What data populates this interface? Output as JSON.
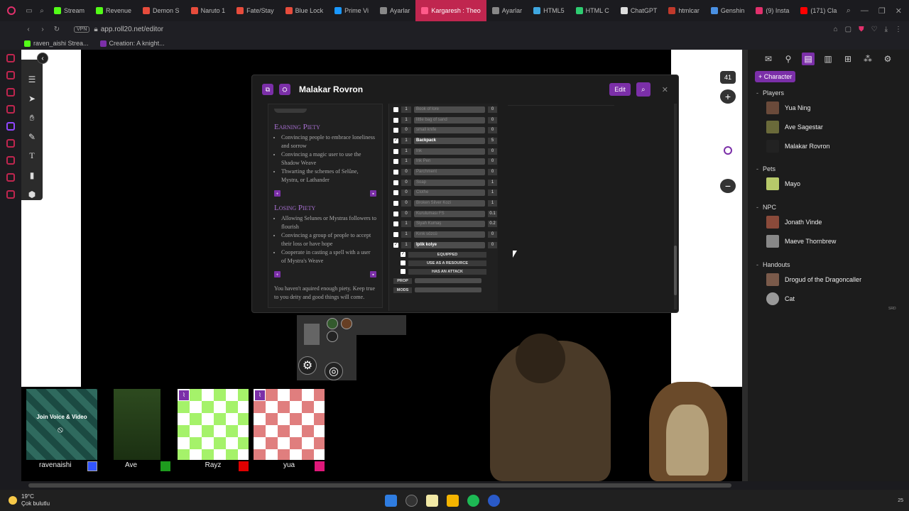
{
  "browser": {
    "tabs": [
      {
        "label": "Stream",
        "color": "#53fc18"
      },
      {
        "label": "Revenue",
        "color": "#53fc18"
      },
      {
        "label": "Demon S",
        "color": "#e74c3c"
      },
      {
        "label": "Naruto 1",
        "color": "#e74c3c"
      },
      {
        "label": "Fate/Stay",
        "color": "#e74c3c"
      },
      {
        "label": "Blue Lock",
        "color": "#e74c3c"
      },
      {
        "label": "Prime Vi",
        "color": "#1a98ff"
      },
      {
        "label": "Ayarlar",
        "color": "#888888"
      },
      {
        "label": "Kargaresh : Theo",
        "color": "#ff5a8a",
        "active": true
      },
      {
        "label": "Ayarlar",
        "color": "#888888"
      },
      {
        "label": "HTML5",
        "color": "#3fa7e0"
      },
      {
        "label": "HTML C",
        "color": "#2ecc71"
      },
      {
        "label": "ChatGPT",
        "color": "#dddddd"
      },
      {
        "label": "htmlcar",
        "color": "#c0392b"
      },
      {
        "label": "Genshin",
        "color": "#4a90e2"
      },
      {
        "label": "(9) Insta",
        "color": "#e1306c"
      },
      {
        "label": "(171) Cla",
        "color": "#ff0000"
      }
    ],
    "url": "app.roll20.net/editor",
    "vpn": "VPN",
    "bookmarks": [
      {
        "label": "raven_aishi Strea...",
        "color": "#53fc18"
      },
      {
        "label": "Creation: A knight...",
        "color": "#7b2fa8"
      }
    ]
  },
  "sheet": {
    "title": "Malakar Rovron",
    "edit_label": "Edit",
    "earning_heading": "Earning Piety",
    "earning": [
      "Convincing people to embrace loneliness and sorrow",
      "Convincing a magic user to use the Shadow Weave",
      "Thwarting the schemes of Selûne, Mystra, or Lathander"
    ],
    "losing_heading": "Losing Piety",
    "losing": [
      "Allowing Selunes or Mystras followers to flourish",
      "Convincing a group of people to accept their loss or have hope",
      "Cooperate in casting a spell with a user of Mystra's Weave"
    ],
    "note": "You haven't aquired enough piety. Keep true to you deity and good things will come.",
    "inventory": [
      {
        "qty": "1",
        "name": "Book of lore",
        "wt": "0",
        "checked": false
      },
      {
        "qty": "1",
        "name": "little bag of sand",
        "wt": "0",
        "checked": false
      },
      {
        "qty": "0",
        "name": "small knife",
        "wt": "0",
        "checked": false
      },
      {
        "qty": "1",
        "name": "Backpack",
        "wt": "5",
        "checked": true,
        "bright": true
      },
      {
        "qty": "1",
        "name": "Ink",
        "wt": "0",
        "checked": false
      },
      {
        "qty": "1",
        "name": "Ink Pen",
        "wt": "0",
        "checked": false
      },
      {
        "qty": "0",
        "name": "Parchment",
        "wt": "0",
        "checked": false
      },
      {
        "qty": "0",
        "name": "Soap",
        "wt": "1",
        "checked": false
      },
      {
        "qty": "0",
        "name": "Clothe",
        "wt": "1",
        "checked": false
      },
      {
        "qty": "0",
        "name": "Broken Silver Kozi",
        "wt": "1",
        "checked": false
      },
      {
        "qty": "0",
        "name": "Kuruluması FS",
        "wt": "0.1",
        "checked": false
      },
      {
        "qty": "1",
        "name": "Siyah Kumaş",
        "wt": "0.2",
        "checked": false
      },
      {
        "qty": "1",
        "name": "Kırık sözcü",
        "wt": "0",
        "checked": false
      },
      {
        "qty": "1",
        "name": "İplik kolye",
        "wt": "0",
        "checked": true,
        "bright": true
      }
    ],
    "sub_options": [
      {
        "label": "EQUIPPED",
        "checked": true
      },
      {
        "label": "USE AS A RESOURCE",
        "checked": false
      },
      {
        "label": "HAS AN ATTACK",
        "checked": false
      }
    ],
    "prop_label": "PROP",
    "mods_label": "MODS"
  },
  "zoom": {
    "value": "41",
    "level_pct": 65
  },
  "players": [
    {
      "name": "ravenaishi",
      "join": "Join Voice & Video",
      "color": "#3355ff"
    },
    {
      "name": "Ave",
      "color": "#1e9c1e"
    },
    {
      "name": "Rayz",
      "color": "#e00000"
    },
    {
      "name": "yua",
      "color": "#e0187a"
    }
  ],
  "journal": {
    "add_label": "+ Character",
    "sections": [
      {
        "title": "Players",
        "items": [
          "Yua Ning",
          "Ave Sagestar",
          "Malakar Rovron"
        ]
      },
      {
        "title": "Pets",
        "items": [
          "Mayo"
        ]
      },
      {
        "title": "NPC",
        "items": [
          "Jonath Vinde",
          "Maeve Thornbrew"
        ]
      },
      {
        "title": "Handouts",
        "items": [
          "Drogud of the Dragoncaller",
          "Cat"
        ]
      }
    ],
    "srd": "SRD"
  },
  "taskbar": {
    "temp": "19°C",
    "weather": "Çok bulutlu",
    "clock": "25"
  },
  "colors": {
    "accent": "#7b2fa8"
  }
}
